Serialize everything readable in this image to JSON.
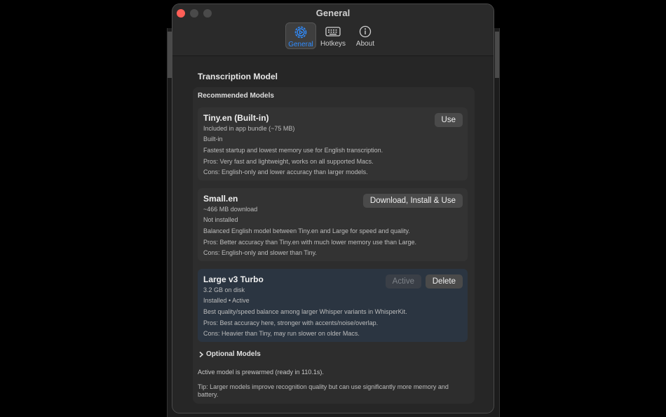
{
  "window": {
    "title": "General"
  },
  "toolbar": {
    "tabs": [
      {
        "label": "General",
        "icon": "gear-icon",
        "active": true
      },
      {
        "label": "Hotkeys",
        "icon": "keyboard-icon",
        "active": false
      },
      {
        "label": "About",
        "icon": "info-icon",
        "active": false
      }
    ]
  },
  "colors": {
    "accent": "#2f8cff",
    "close": "#ff5f57",
    "active_card": "#2b3541"
  },
  "section": {
    "title": "Transcription Model"
  },
  "recommended": {
    "title": "Recommended Models",
    "models": [
      {
        "name": "Tiny.en (Built-in)",
        "size": "Included in app bundle (~75 MB)",
        "status": "Built-in",
        "description": "Fastest startup and lowest memory use for English transcription.",
        "pros": "Pros: Very fast and lightweight, works on all supported Macs.",
        "cons": "Cons: English-only and lower accuracy than larger models.",
        "action": "Use"
      },
      {
        "name": "Small.en",
        "size": "~466 MB download",
        "status": "Not installed",
        "description": "Balanced English model between Tiny.en and Large for speed and quality.",
        "pros": "Pros: Better accuracy than Tiny.en with much lower memory use than Large.",
        "cons": "Cons: English-only and slower than Tiny.",
        "action": "Download, Install & Use"
      },
      {
        "name": "Large v3 Turbo",
        "size": "3.2 GB on disk",
        "status": "Installed • Active",
        "description": "Best quality/speed balance among larger Whisper variants in WhisperKit.",
        "pros": "Pros: Best accuracy here, stronger with accents/noise/overlap.",
        "cons": "Cons: Heavier than Tiny, may run slower on older Macs.",
        "action": "Active",
        "secondary_action": "Delete"
      }
    ]
  },
  "optional": {
    "label": "Optional Models"
  },
  "status_text": "Active model is prewarmed (ready in 110.1s).",
  "tip_text": "Tip: Larger models improve recognition quality but can use significantly more memory and battery."
}
